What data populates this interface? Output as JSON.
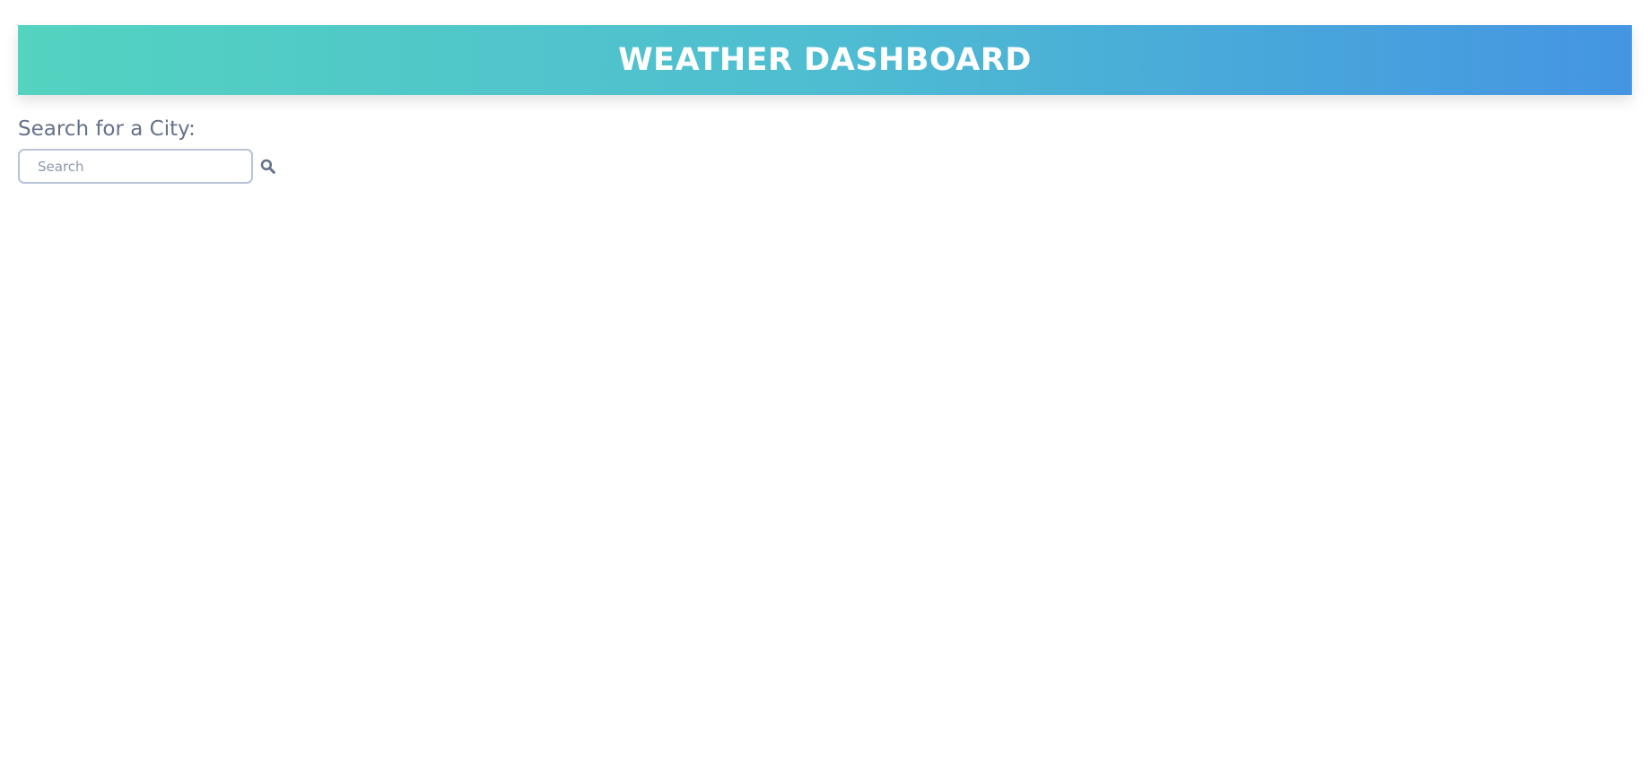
{
  "header": {
    "title": "WEATHER DASHBOARD"
  },
  "search": {
    "label": "Search for a City:",
    "placeholder": "Search",
    "value": "",
    "button_icon": "search-icon"
  },
  "colors": {
    "header_gradient_start": "#53d3c0",
    "header_gradient_end": "#4495e2",
    "label_text": "#66718a",
    "input_border": "#b8c3d8",
    "icon": "#66718a"
  }
}
